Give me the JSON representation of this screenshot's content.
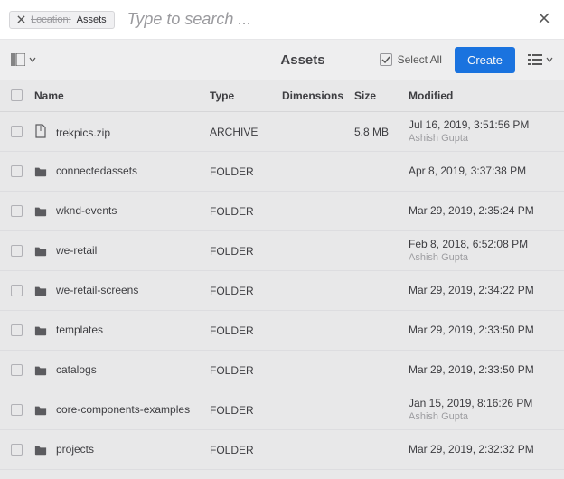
{
  "search": {
    "placeholder": "Type to search ...",
    "close_label": "Close"
  },
  "location_chip": {
    "label": "Location:",
    "value": "Assets"
  },
  "toolbar": {
    "title": "Assets",
    "select_all": "Select All",
    "create": "Create"
  },
  "columns": {
    "name": "Name",
    "type": "Type",
    "dimensions": "Dimensions",
    "size": "Size",
    "modified": "Modified"
  },
  "rows": [
    {
      "icon": "archive",
      "name": "trekpics.zip",
      "type": "ARCHIVE",
      "dimensions": "",
      "size": "5.8 MB",
      "modified": "Jul 16, 2019, 3:51:56 PM",
      "modified_by": "Ashish Gupta"
    },
    {
      "icon": "folder",
      "name": "connectedassets",
      "type": "FOLDER",
      "dimensions": "",
      "size": "",
      "modified": "Apr 8, 2019, 3:37:38 PM",
      "modified_by": ""
    },
    {
      "icon": "folder",
      "name": "wknd-events",
      "type": "FOLDER",
      "dimensions": "",
      "size": "",
      "modified": "Mar 29, 2019, 2:35:24 PM",
      "modified_by": ""
    },
    {
      "icon": "folder",
      "name": "we-retail",
      "type": "FOLDER",
      "dimensions": "",
      "size": "",
      "modified": "Feb 8, 2018, 6:52:08 PM",
      "modified_by": "Ashish Gupta"
    },
    {
      "icon": "folder",
      "name": "we-retail-screens",
      "type": "FOLDER",
      "dimensions": "",
      "size": "",
      "modified": "Mar 29, 2019, 2:34:22 PM",
      "modified_by": ""
    },
    {
      "icon": "folder",
      "name": "templates",
      "type": "FOLDER",
      "dimensions": "",
      "size": "",
      "modified": "Mar 29, 2019, 2:33:50 PM",
      "modified_by": ""
    },
    {
      "icon": "folder",
      "name": "catalogs",
      "type": "FOLDER",
      "dimensions": "",
      "size": "",
      "modified": "Mar 29, 2019, 2:33:50 PM",
      "modified_by": ""
    },
    {
      "icon": "folder",
      "name": "core-components-examples",
      "type": "FOLDER",
      "dimensions": "",
      "size": "",
      "modified": "Jan 15, 2019, 8:16:26 PM",
      "modified_by": "Ashish Gupta"
    },
    {
      "icon": "folder",
      "name": "projects",
      "type": "FOLDER",
      "dimensions": "",
      "size": "",
      "modified": "Mar 29, 2019, 2:32:32 PM",
      "modified_by": ""
    }
  ]
}
